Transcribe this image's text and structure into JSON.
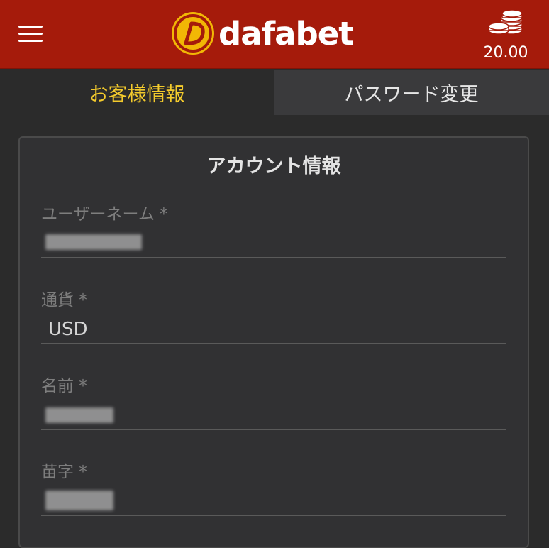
{
  "header": {
    "brand": "dafabet",
    "balance": "20.00"
  },
  "tabs": [
    {
      "label": "お客様情報",
      "active": true
    },
    {
      "label": "パスワード変更",
      "active": false
    }
  ],
  "card": {
    "title": "アカウント情報",
    "fields": [
      {
        "label": "ユーザーネーム *",
        "value": "",
        "masked": true
      },
      {
        "label": "通貨 *",
        "value": "USD",
        "masked": false
      },
      {
        "label": "名前 *",
        "value": "",
        "masked": true
      },
      {
        "label": "苗字 *",
        "value": "",
        "masked": true
      }
    ]
  },
  "colors": {
    "header_bg": "#a51b0b",
    "active_tab_text": "#f4cb2c",
    "logo_gold": "#f2b705"
  },
  "icons": {
    "menu": "hamburger-menu-icon",
    "balance": "coin-stack-icon"
  }
}
